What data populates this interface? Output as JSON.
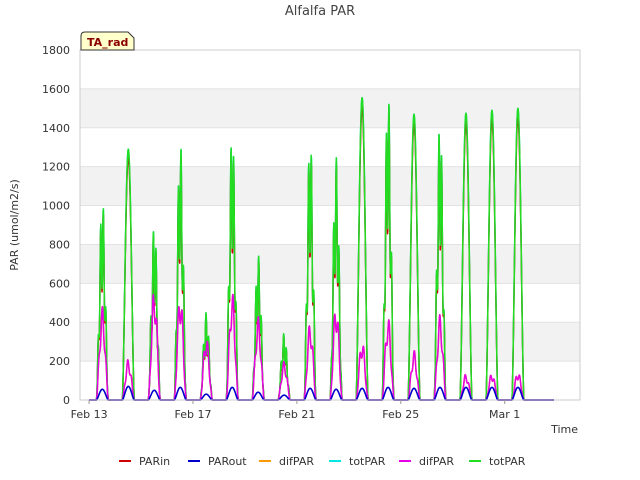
{
  "chart_data": {
    "type": "line",
    "title": "Alfalfa PAR",
    "xlabel": "Time",
    "ylabel": "PAR (umol/m2/s)",
    "badge": "TA_rad",
    "x_domain": [
      "Feb 13",
      "Mar 3"
    ],
    "ylim": [
      0,
      1800
    ],
    "yticks": [
      0,
      200,
      400,
      600,
      800,
      1000,
      1200,
      1400,
      1600,
      1800
    ],
    "xticks": [
      {
        "label": "Feb 13",
        "day": 0
      },
      {
        "label": "Feb 17",
        "day": 4
      },
      {
        "label": "Feb 21",
        "day": 8
      },
      {
        "label": "Feb 25",
        "day": 12
      },
      {
        "label": "Mar 1",
        "day": 16
      }
    ],
    "grid": true,
    "legend_position": "bottom",
    "days": [
      {
        "day": 0,
        "peak": 1040,
        "dif": 480,
        "out": 55
      },
      {
        "day": 1,
        "peak": 1290,
        "dif": 210,
        "out": 70
      },
      {
        "day": 2,
        "peak": 910,
        "dif": 580,
        "out": 50
      },
      {
        "day": 3,
        "peak": 1330,
        "dif": 560,
        "out": 65
      },
      {
        "day": 4,
        "peak": 450,
        "dif": 330,
        "out": 30
      },
      {
        "day": 5,
        "peak": 1400,
        "dif": 560,
        "out": 65
      },
      {
        "day": 6,
        "peak": 750,
        "dif": 430,
        "out": 40
      },
      {
        "day": 7,
        "peak": 345,
        "dif": 200,
        "out": 25
      },
      {
        "day": 8,
        "peak": 1360,
        "dif": 400,
        "out": 60
      },
      {
        "day": 9,
        "peak": 1250,
        "dif": 500,
        "out": 55
      },
      {
        "day": 10,
        "peak": 1555,
        "dif": 310,
        "out": 60
      },
      {
        "day": 11,
        "peak": 1600,
        "dif": 430,
        "out": 65
      },
      {
        "day": 12,
        "peak": 1470,
        "dif": 255,
        "out": 60
      },
      {
        "day": 13,
        "peak": 1445,
        "dif": 440,
        "out": 65
      },
      {
        "day": 14,
        "peak": 1475,
        "dif": 135,
        "out": 65
      },
      {
        "day": 15,
        "peak": 1490,
        "dif": 140,
        "out": 65
      },
      {
        "day": 16,
        "peak": 1500,
        "dif": 148,
        "out": 65
      }
    ],
    "series": [
      {
        "name": "PARin",
        "color": "#cc0000",
        "key": "parin"
      },
      {
        "name": "PARout",
        "color": "#0000cc",
        "key": "parout"
      },
      {
        "name": "difPAR",
        "color": "#ff9900",
        "key": "dif1"
      },
      {
        "name": "totPAR",
        "color": "#00e5e5",
        "key": "tot1"
      },
      {
        "name": "difPAR",
        "color": "#e600e6",
        "key": "dif2"
      },
      {
        "name": "totPAR",
        "color": "#22dd22",
        "key": "tot2"
      }
    ]
  }
}
